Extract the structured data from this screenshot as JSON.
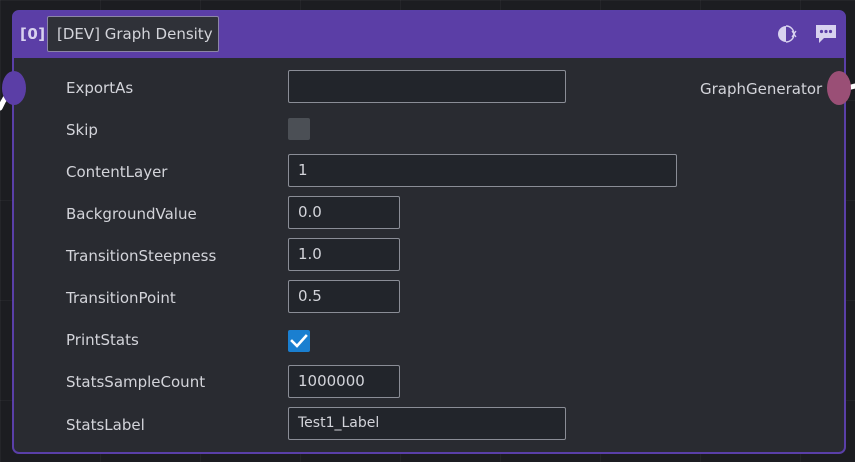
{
  "node": {
    "index": "[0]",
    "title": "[DEV] Graph Density",
    "output_port_label": "GraphGenerator"
  },
  "colors": {
    "header": "#5b3ea6",
    "input_port": "#5b3ea6",
    "output_port": "#9a4f76",
    "checkbox_checked": "#1a7fd0",
    "body": "#292b31"
  },
  "icons": [
    "half-circle-x-toggle-icon",
    "comment-icon"
  ],
  "properties": {
    "export_as": {
      "label": "ExportAs",
      "value": ""
    },
    "skip": {
      "label": "Skip",
      "checked": false
    },
    "content_layer": {
      "label": "ContentLayer",
      "value": "1"
    },
    "background_value": {
      "label": "BackgroundValue",
      "value": "0.0"
    },
    "transition_steepness": {
      "label": "TransitionSteepness",
      "value": "1.0"
    },
    "transition_point": {
      "label": "TransitionPoint",
      "value": "0.5"
    },
    "print_stats": {
      "label": "PrintStats",
      "checked": true
    },
    "stats_sample_count": {
      "label": "StatsSampleCount",
      "value": "1000000"
    },
    "stats_label": {
      "label": "StatsLabel",
      "value": "Test1_Label"
    }
  }
}
